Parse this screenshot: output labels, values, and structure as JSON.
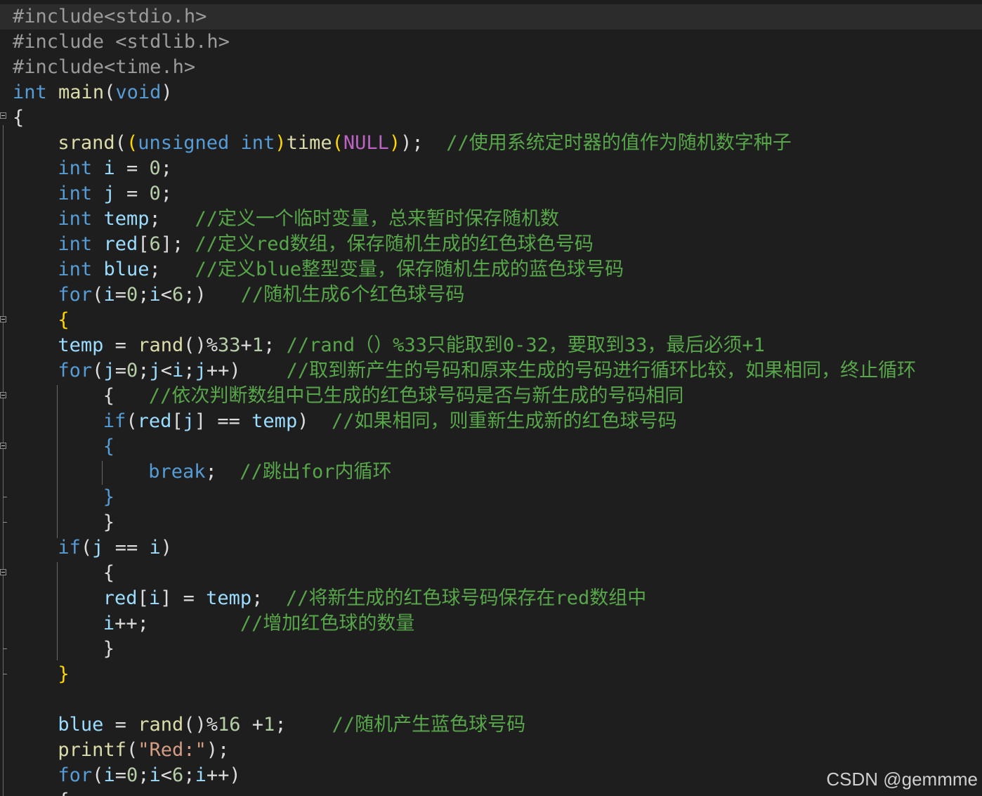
{
  "editor": {
    "theme_colors": {
      "background": "#1e1e1e",
      "current_line": "#2c2c2c",
      "plain_text": "#dcdcdc",
      "keyword": "#569cd6",
      "function": "#dcdcaa",
      "variable": "#9cdcfe",
      "number": "#b5cea8",
      "string": "#d69d85",
      "comment": "#57a64a",
      "preprocessor": "#9b9b9b",
      "macro": "#bd63c5",
      "brace_level": "#ffd700"
    },
    "lines": [
      {
        "indent": 0,
        "tokens": [
          {
            "t": "#include<stdio.h>",
            "c": "preprocessor"
          }
        ]
      },
      {
        "indent": 0,
        "tokens": [
          {
            "t": "#include <stdlib.h>",
            "c": "preprocessor"
          }
        ]
      },
      {
        "indent": 0,
        "tokens": [
          {
            "t": "#include<time.h>",
            "c": "preprocessor"
          }
        ]
      },
      {
        "indent": 0,
        "tokens": [
          {
            "t": "int",
            "c": "keyword"
          },
          {
            "t": " ",
            "c": "plain"
          },
          {
            "t": "main",
            "c": "function"
          },
          {
            "t": "(",
            "c": "plain"
          },
          {
            "t": "void",
            "c": "keyword"
          },
          {
            "t": ")",
            "c": "plain"
          }
        ]
      },
      {
        "indent": 0,
        "tokens": [
          {
            "t": "{",
            "c": "plain"
          }
        ]
      },
      {
        "indent": 4,
        "tokens": [
          {
            "t": "srand",
            "c": "function"
          },
          {
            "t": "(",
            "c": "plain"
          },
          {
            "t": "(",
            "c": "brace_level"
          },
          {
            "t": "unsigned",
            "c": "keyword"
          },
          {
            "t": " ",
            "c": "plain"
          },
          {
            "t": "int",
            "c": "keyword"
          },
          {
            "t": ")",
            "c": "brace_level"
          },
          {
            "t": "time",
            "c": "function"
          },
          {
            "t": "(",
            "c": "brace_level"
          },
          {
            "t": "NULL",
            "c": "macro"
          },
          {
            "t": ")",
            "c": "brace_level"
          },
          {
            "t": ");  ",
            "c": "plain"
          },
          {
            "t": "//使用系统定时器的值作为随机数字种子",
            "c": "comment"
          }
        ]
      },
      {
        "indent": 4,
        "tokens": [
          {
            "t": "int",
            "c": "keyword"
          },
          {
            "t": " ",
            "c": "plain"
          },
          {
            "t": "i",
            "c": "variable"
          },
          {
            "t": " = ",
            "c": "plain"
          },
          {
            "t": "0",
            "c": "number"
          },
          {
            "t": ";",
            "c": "plain"
          }
        ]
      },
      {
        "indent": 4,
        "tokens": [
          {
            "t": "int",
            "c": "keyword"
          },
          {
            "t": " ",
            "c": "plain"
          },
          {
            "t": "j",
            "c": "variable"
          },
          {
            "t": " = ",
            "c": "plain"
          },
          {
            "t": "0",
            "c": "number"
          },
          {
            "t": ";",
            "c": "plain"
          }
        ]
      },
      {
        "indent": 4,
        "tokens": [
          {
            "t": "int",
            "c": "keyword"
          },
          {
            "t": " ",
            "c": "plain"
          },
          {
            "t": "temp",
            "c": "variable"
          },
          {
            "t": ";   ",
            "c": "plain"
          },
          {
            "t": "//定义一个临时变量，总来暂时保存随机数",
            "c": "comment"
          }
        ]
      },
      {
        "indent": 4,
        "tokens": [
          {
            "t": "int",
            "c": "keyword"
          },
          {
            "t": " ",
            "c": "plain"
          },
          {
            "t": "red",
            "c": "variable"
          },
          {
            "t": "[",
            "c": "plain"
          },
          {
            "t": "6",
            "c": "number"
          },
          {
            "t": "]; ",
            "c": "plain"
          },
          {
            "t": "//定义red数组，保存随机生成的红色球色号码",
            "c": "comment"
          }
        ]
      },
      {
        "indent": 4,
        "tokens": [
          {
            "t": "int",
            "c": "keyword"
          },
          {
            "t": " ",
            "c": "plain"
          },
          {
            "t": "blue",
            "c": "variable"
          },
          {
            "t": ";   ",
            "c": "plain"
          },
          {
            "t": "//定义blue整型变量，保存随机生成的蓝色球号码",
            "c": "comment"
          }
        ]
      },
      {
        "indent": 4,
        "tokens": [
          {
            "t": "for",
            "c": "keyword"
          },
          {
            "t": "(",
            "c": "plain"
          },
          {
            "t": "i",
            "c": "variable"
          },
          {
            "t": "=",
            "c": "plain"
          },
          {
            "t": "0",
            "c": "number"
          },
          {
            "t": ";",
            "c": "plain"
          },
          {
            "t": "i",
            "c": "variable"
          },
          {
            "t": "<",
            "c": "plain"
          },
          {
            "t": "6",
            "c": "number"
          },
          {
            "t": ";)   ",
            "c": "plain"
          },
          {
            "t": "//随机生成6个红色球号码",
            "c": "comment"
          }
        ]
      },
      {
        "indent": 4,
        "tokens": [
          {
            "t": "{",
            "c": "brace_level"
          }
        ]
      },
      {
        "indent": 4,
        "tokens": [
          {
            "t": "temp",
            "c": "variable"
          },
          {
            "t": " = ",
            "c": "plain"
          },
          {
            "t": "rand",
            "c": "function"
          },
          {
            "t": "()%",
            "c": "plain"
          },
          {
            "t": "33",
            "c": "number"
          },
          {
            "t": "+",
            "c": "plain"
          },
          {
            "t": "1",
            "c": "number"
          },
          {
            "t": "; ",
            "c": "plain"
          },
          {
            "t": "//rand（）%33只能取到0-32，要取到33，最后必须+1",
            "c": "comment"
          }
        ]
      },
      {
        "indent": 4,
        "tokens": [
          {
            "t": "for",
            "c": "keyword"
          },
          {
            "t": "(",
            "c": "plain"
          },
          {
            "t": "j",
            "c": "variable"
          },
          {
            "t": "=",
            "c": "plain"
          },
          {
            "t": "0",
            "c": "number"
          },
          {
            "t": ";",
            "c": "plain"
          },
          {
            "t": "j",
            "c": "variable"
          },
          {
            "t": "<",
            "c": "plain"
          },
          {
            "t": "i",
            "c": "variable"
          },
          {
            "t": ";",
            "c": "plain"
          },
          {
            "t": "j",
            "c": "variable"
          },
          {
            "t": "++)    ",
            "c": "plain"
          },
          {
            "t": "//取到新产生的号码和原来生成的号码进行循环比较，如果相同，终止循环",
            "c": "comment"
          }
        ]
      },
      {
        "indent": 8,
        "tokens": [
          {
            "t": "{   ",
            "c": "plain"
          },
          {
            "t": "//依次判断数组中已生成的红色球号码是否与新生成的号码相同",
            "c": "comment"
          }
        ]
      },
      {
        "indent": 8,
        "tokens": [
          {
            "t": "if",
            "c": "keyword"
          },
          {
            "t": "(",
            "c": "plain"
          },
          {
            "t": "red",
            "c": "variable"
          },
          {
            "t": "[",
            "c": "plain"
          },
          {
            "t": "j",
            "c": "variable"
          },
          {
            "t": "] == ",
            "c": "plain"
          },
          {
            "t": "temp",
            "c": "variable"
          },
          {
            "t": ")  ",
            "c": "plain"
          },
          {
            "t": "//如果相同，则重新生成新的红色球号码",
            "c": "comment"
          }
        ]
      },
      {
        "indent": 8,
        "tokens": [
          {
            "t": "{",
            "c": "keyword"
          }
        ]
      },
      {
        "indent": 12,
        "tokens": [
          {
            "t": "break",
            "c": "keyword"
          },
          {
            "t": ";  ",
            "c": "plain"
          },
          {
            "t": "//跳出for内循环",
            "c": "comment"
          }
        ]
      },
      {
        "indent": 8,
        "tokens": [
          {
            "t": "}",
            "c": "keyword"
          }
        ]
      },
      {
        "indent": 8,
        "tokens": [
          {
            "t": "}",
            "c": "plain"
          }
        ]
      },
      {
        "indent": 4,
        "tokens": [
          {
            "t": "if",
            "c": "keyword"
          },
          {
            "t": "(",
            "c": "plain"
          },
          {
            "t": "j",
            "c": "variable"
          },
          {
            "t": " == ",
            "c": "plain"
          },
          {
            "t": "i",
            "c": "variable"
          },
          {
            "t": ")",
            "c": "plain"
          }
        ]
      },
      {
        "indent": 8,
        "tokens": [
          {
            "t": "{",
            "c": "plain"
          }
        ]
      },
      {
        "indent": 8,
        "tokens": [
          {
            "t": "red",
            "c": "variable"
          },
          {
            "t": "[",
            "c": "plain"
          },
          {
            "t": "i",
            "c": "variable"
          },
          {
            "t": "] = ",
            "c": "plain"
          },
          {
            "t": "temp",
            "c": "variable"
          },
          {
            "t": ";  ",
            "c": "plain"
          },
          {
            "t": "//将新生成的红色球号码保存在red数组中",
            "c": "comment"
          }
        ]
      },
      {
        "indent": 8,
        "tokens": [
          {
            "t": "i",
            "c": "variable"
          },
          {
            "t": "++;        ",
            "c": "plain"
          },
          {
            "t": "//增加红色球的数量",
            "c": "comment"
          }
        ]
      },
      {
        "indent": 8,
        "tokens": [
          {
            "t": "}",
            "c": "plain"
          }
        ]
      },
      {
        "indent": 4,
        "tokens": [
          {
            "t": "}",
            "c": "brace_level"
          }
        ]
      },
      {
        "indent": 0,
        "tokens": []
      },
      {
        "indent": 4,
        "tokens": [
          {
            "t": "blue",
            "c": "variable"
          },
          {
            "t": " = ",
            "c": "plain"
          },
          {
            "t": "rand",
            "c": "function"
          },
          {
            "t": "()%",
            "c": "plain"
          },
          {
            "t": "16",
            "c": "number"
          },
          {
            "t": " +",
            "c": "plain"
          },
          {
            "t": "1",
            "c": "number"
          },
          {
            "t": ";    ",
            "c": "plain"
          },
          {
            "t": "//随机产生蓝色球号码",
            "c": "comment"
          }
        ]
      },
      {
        "indent": 4,
        "tokens": [
          {
            "t": "printf",
            "c": "function"
          },
          {
            "t": "(",
            "c": "plain"
          },
          {
            "t": "\"Red:\"",
            "c": "string"
          },
          {
            "t": ");",
            "c": "plain"
          }
        ]
      },
      {
        "indent": 4,
        "tokens": [
          {
            "t": "for",
            "c": "keyword"
          },
          {
            "t": "(",
            "c": "plain"
          },
          {
            "t": "i",
            "c": "variable"
          },
          {
            "t": "=",
            "c": "plain"
          },
          {
            "t": "0",
            "c": "number"
          },
          {
            "t": ";",
            "c": "plain"
          },
          {
            "t": "i",
            "c": "variable"
          },
          {
            "t": "<",
            "c": "plain"
          },
          {
            "t": "6",
            "c": "number"
          },
          {
            "t": ";",
            "c": "plain"
          },
          {
            "t": "i",
            "c": "variable"
          },
          {
            "t": "++)",
            "c": "plain"
          }
        ]
      },
      {
        "indent": 4,
        "tokens": [
          {
            "t": "{",
            "c": "plain"
          }
        ]
      }
    ]
  },
  "watermark": "CSDN @gemmme"
}
